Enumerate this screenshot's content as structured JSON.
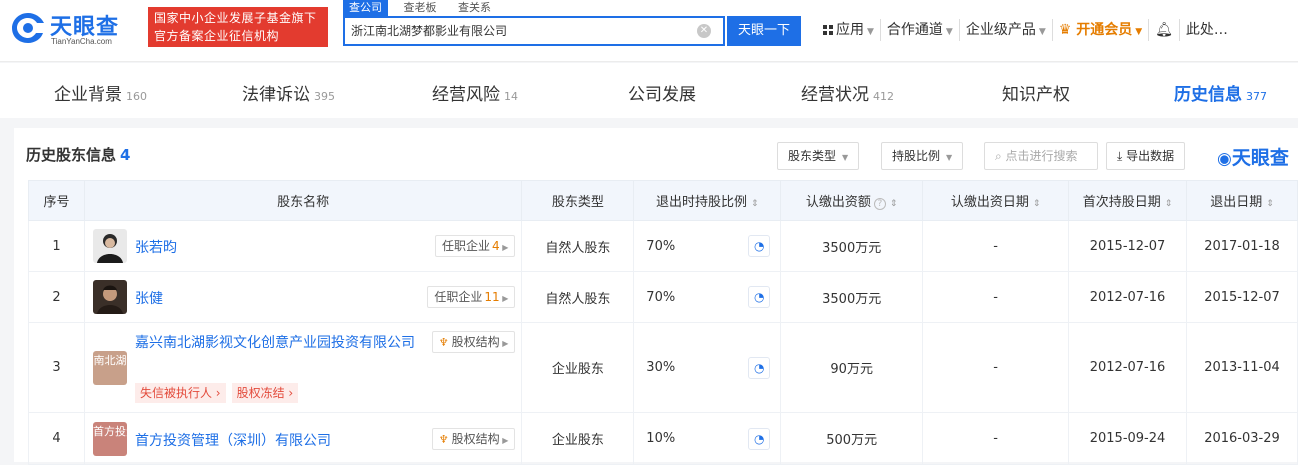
{
  "brand": {
    "name": "天眼查",
    "domain": "TianYanCha.com",
    "color": "#1e6fe6"
  },
  "gov_badge": {
    "line1": "国家中小企业发展子基金旗下",
    "line2": "官方备案企业征信机构"
  },
  "search": {
    "tabs": [
      "查公司",
      "查老板",
      "查关系"
    ],
    "active_tab": "查公司",
    "value": "浙江南北湖梦都影业有限公司",
    "button": "天眼一下"
  },
  "nav": {
    "apps": "应用",
    "channel": "合作通道",
    "enterprise": "企业级产品",
    "vip": "开通会员",
    "more": "此处…"
  },
  "main_tabs": [
    {
      "label": "企业背景",
      "count": "160"
    },
    {
      "label": "法律诉讼",
      "count": "395"
    },
    {
      "label": "经营风险",
      "count": "14"
    },
    {
      "label": "公司发展",
      "count": ""
    },
    {
      "label": "经营状况",
      "count": "412"
    },
    {
      "label": "知识产权",
      "count": ""
    },
    {
      "label": "历史信息",
      "count": "377"
    }
  ],
  "section": {
    "title": "历史股东信息",
    "count": "4",
    "filter_type": "股东类型",
    "filter_ratio": "持股比例",
    "search_placeholder": "点击进行搜索",
    "export": "导出数据",
    "brand": "天眼查"
  },
  "table": {
    "headers": [
      "序号",
      "股东名称",
      "股东类型",
      "退出时持股比例",
      "认缴出资额",
      "认缴出资日期",
      "首次持股日期",
      "退出日期"
    ],
    "rows": [
      {
        "no": "1",
        "name": "张若昀",
        "avatar": "photo",
        "tag": "任职企业",
        "tag_count": "4",
        "type": "自然人股东",
        "ratio": "70%",
        "amount": "3500万元",
        "sub_date": "-",
        "first_date": "2015-12-07",
        "exit_date": "2017-01-18"
      },
      {
        "no": "2",
        "name": "张健",
        "avatar": "photo",
        "tag": "任职企业",
        "tag_count": "11",
        "type": "自然人股东",
        "ratio": "70%",
        "amount": "3500万元",
        "sub_date": "-",
        "first_date": "2012-07-16",
        "exit_date": "2015-12-07"
      },
      {
        "no": "3",
        "name": "嘉兴南北湖影视文化创意产业园投资有限公司",
        "avatar_text": "南北湖",
        "tag": "股权结构",
        "risks": [
          "失信被执行人",
          "股权冻结"
        ],
        "type": "企业股东",
        "ratio": "30%",
        "amount": "90万元",
        "sub_date": "-",
        "first_date": "2012-07-16",
        "exit_date": "2013-11-04"
      },
      {
        "no": "4",
        "name": "首方投资管理（深圳）有限公司",
        "avatar_text": "首方投资",
        "tag": "股权结构",
        "type": "企业股东",
        "ratio": "10%",
        "amount": "500万元",
        "sub_date": "-",
        "first_date": "2015-09-24",
        "exit_date": "2016-03-29"
      }
    ]
  }
}
